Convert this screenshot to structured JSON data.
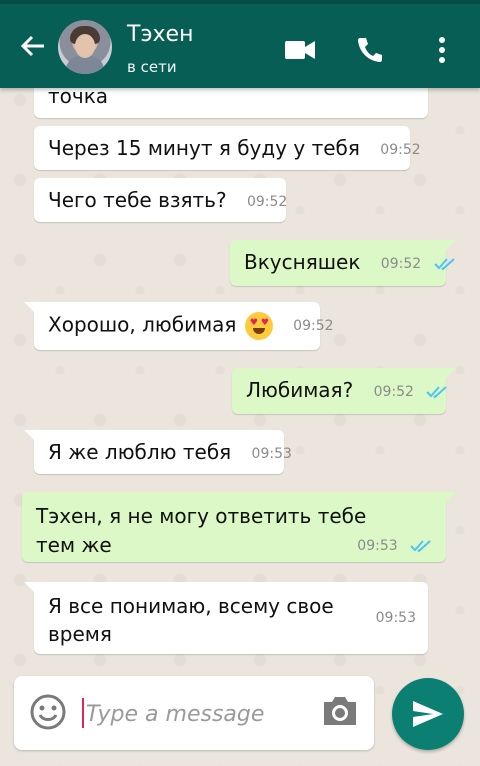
{
  "header": {
    "contact_name": "Тэхен",
    "contact_status": "в сети",
    "icons": [
      "back-arrow-icon",
      "video-call-icon",
      "voice-call-icon",
      "more-vert-icon"
    ],
    "colors": {
      "appbar": "#075e54",
      "out_bubble": "#dcf8c6",
      "in_bubble": "#ffffff",
      "read_ticks": "#4fc3f7",
      "send_button": "#0b7f72"
    }
  },
  "messages": [
    {
      "dir": "in",
      "text": "точка",
      "time": ""
    },
    {
      "dir": "in",
      "text": "Через 15 минут я буду у тебя",
      "time": "09:52"
    },
    {
      "dir": "in",
      "text": "Чего тебе взять?",
      "time": "09:52"
    },
    {
      "dir": "out",
      "text": "Вкусняшек",
      "time": "09:52"
    },
    {
      "dir": "in",
      "text": "Хорошо, любимая",
      "time": "09:52",
      "emoji": "smiling-face-with-heart-eyes"
    },
    {
      "dir": "out",
      "text": "Любимая?",
      "time": "09:52"
    },
    {
      "dir": "in",
      "text": "Я же люблю тебя",
      "time": "09:53"
    },
    {
      "dir": "out",
      "lines": [
        "Тэхен, я не могу ответить тебе",
        "тем же"
      ],
      "time": "09:53"
    },
    {
      "dir": "in",
      "lines": [
        "Я все понимаю, всему свое",
        "время"
      ],
      "time": "09:53"
    }
  ],
  "composer": {
    "placeholder": "Type a message"
  }
}
